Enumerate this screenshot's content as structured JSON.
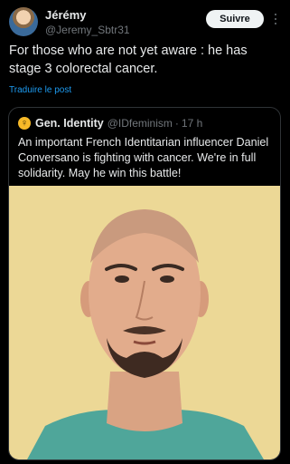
{
  "post": {
    "author_name": "Jérémy",
    "author_handle": "@Jeremy_Sbtr31",
    "follow_label": "Suivre",
    "text": "For those who are not yet aware : he has stage 3 colorectal cancer.",
    "translate_label": "Traduire le post"
  },
  "quoted_post": {
    "author_name": "Gen. Identity",
    "author_handle": "@IDfeminism",
    "separator": "·",
    "time": "17 h",
    "badge_icon": "venus-icon",
    "text": "An important French Identitarian influencer Daniel Conversano is fighting with cancer. We're in full solidarity. May he win this battle!"
  },
  "icons": {
    "more": "more-options-icon",
    "avatar": "avatar-image"
  },
  "colors": {
    "background": "#000000",
    "text": "#e7e9ea",
    "secondary_text": "#71767b",
    "link": "#1d9bf0",
    "follow_button": "#eff3f4",
    "border": "#2f3336",
    "badge": "#f7b928"
  }
}
